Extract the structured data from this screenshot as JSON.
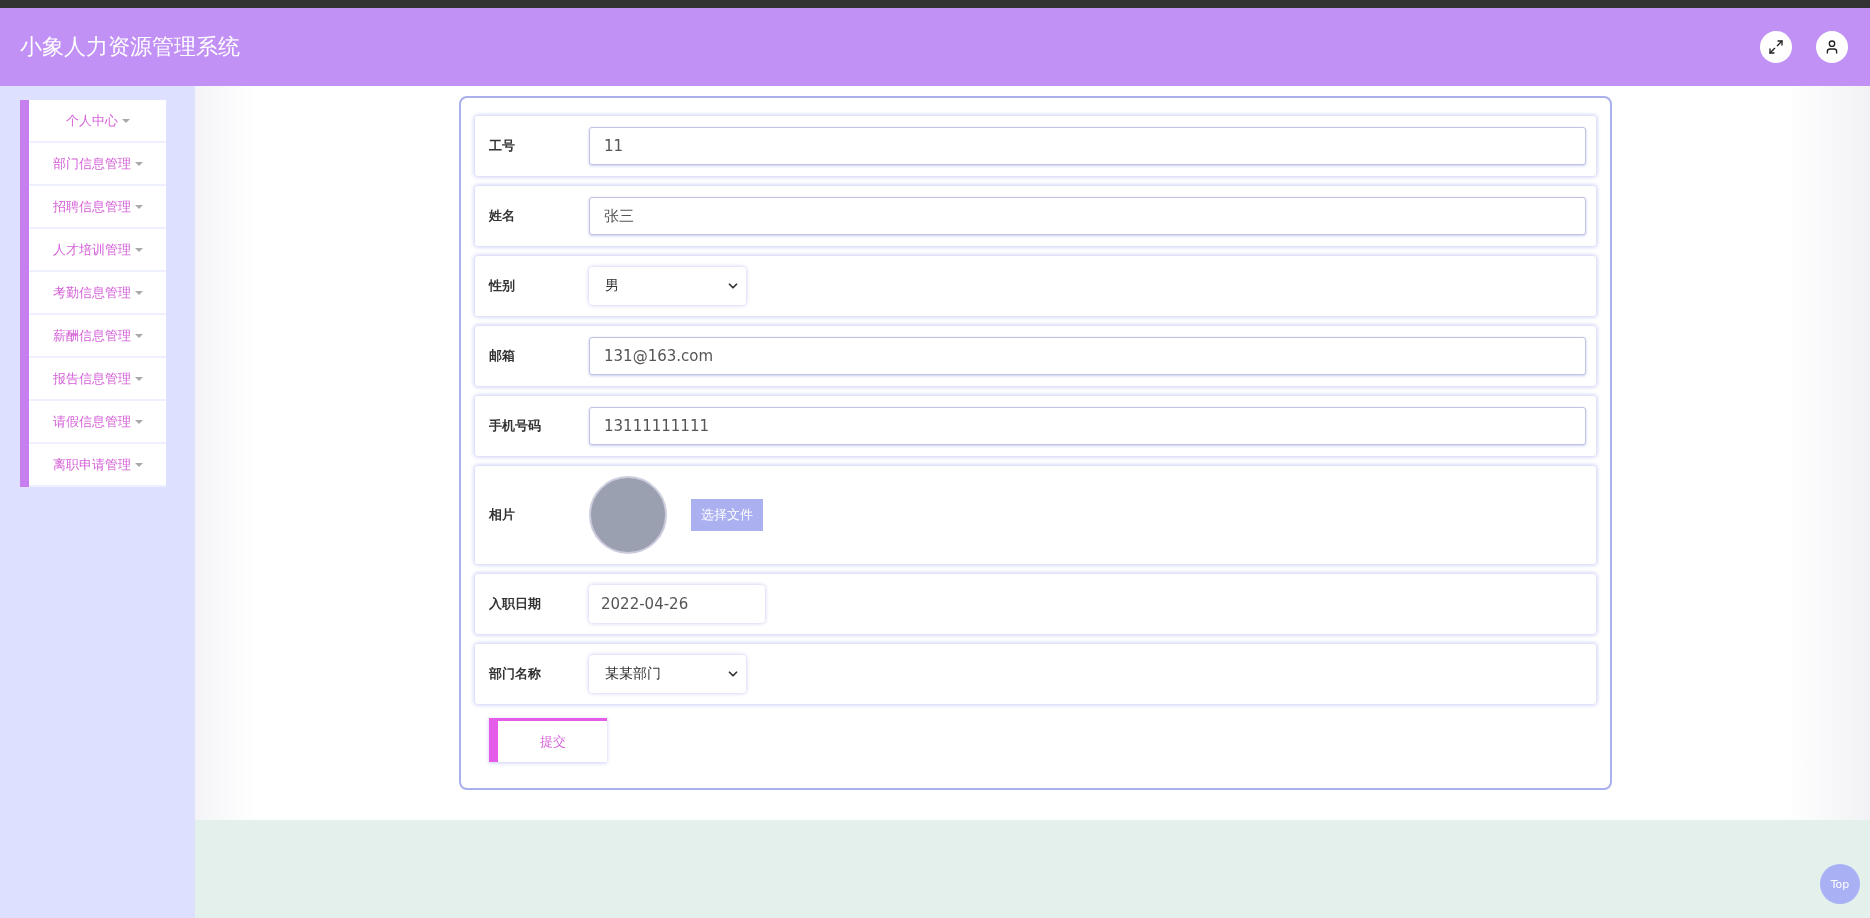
{
  "header": {
    "title": "小象人力资源管理系统"
  },
  "sidebar": {
    "items": [
      {
        "label": "个人中心"
      },
      {
        "label": "部门信息管理"
      },
      {
        "label": "招聘信息管理"
      },
      {
        "label": "人才培训管理"
      },
      {
        "label": "考勤信息管理"
      },
      {
        "label": "薪酬信息管理"
      },
      {
        "label": "报告信息管理"
      },
      {
        "label": "请假信息管理"
      },
      {
        "label": "离职申请管理"
      }
    ]
  },
  "form": {
    "fields": [
      {
        "kind": "text",
        "label": "工号",
        "value": "11"
      },
      {
        "kind": "text",
        "label": "姓名",
        "value": "张三"
      },
      {
        "kind": "select",
        "label": "性别",
        "value": "男"
      },
      {
        "kind": "text",
        "label": "邮箱",
        "value": "131@163.com"
      },
      {
        "kind": "text",
        "label": "手机号码",
        "value": "13111111111"
      },
      {
        "kind": "photo",
        "label": "相片",
        "button": "选择文件"
      },
      {
        "kind": "date",
        "label": "入职日期",
        "value": "2022-04-26"
      },
      {
        "kind": "select",
        "label": "部门名称",
        "value": "某某部门"
      }
    ],
    "submit": "提交"
  },
  "back_to_top": "Top"
}
